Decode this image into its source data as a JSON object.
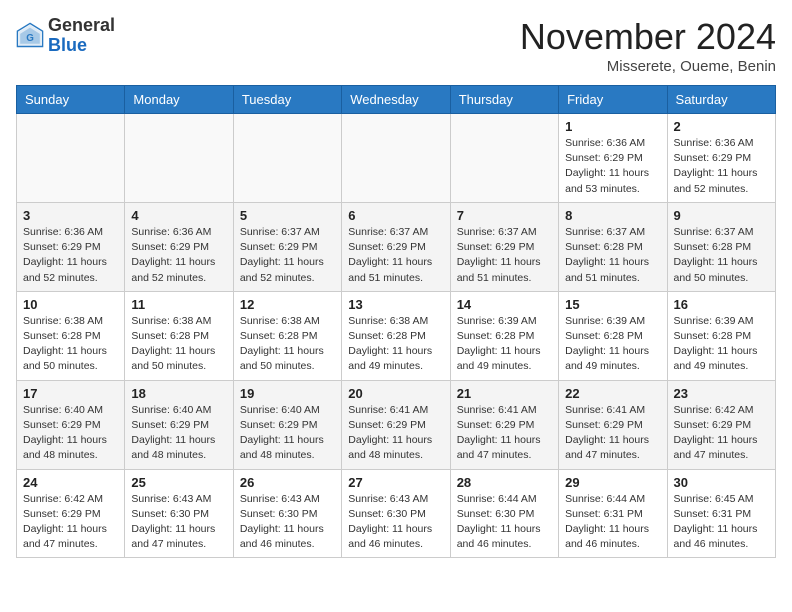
{
  "header": {
    "logo_general": "General",
    "logo_blue": "Blue",
    "month_title": "November 2024",
    "location": "Misserete, Oueme, Benin"
  },
  "weekdays": [
    "Sunday",
    "Monday",
    "Tuesday",
    "Wednesday",
    "Thursday",
    "Friday",
    "Saturday"
  ],
  "weeks": [
    [
      {
        "day": "",
        "detail": ""
      },
      {
        "day": "",
        "detail": ""
      },
      {
        "day": "",
        "detail": ""
      },
      {
        "day": "",
        "detail": ""
      },
      {
        "day": "",
        "detail": ""
      },
      {
        "day": "1",
        "detail": "Sunrise: 6:36 AM\nSunset: 6:29 PM\nDaylight: 11 hours\nand 53 minutes."
      },
      {
        "day": "2",
        "detail": "Sunrise: 6:36 AM\nSunset: 6:29 PM\nDaylight: 11 hours\nand 52 minutes."
      }
    ],
    [
      {
        "day": "3",
        "detail": "Sunrise: 6:36 AM\nSunset: 6:29 PM\nDaylight: 11 hours\nand 52 minutes."
      },
      {
        "day": "4",
        "detail": "Sunrise: 6:36 AM\nSunset: 6:29 PM\nDaylight: 11 hours\nand 52 minutes."
      },
      {
        "day": "5",
        "detail": "Sunrise: 6:37 AM\nSunset: 6:29 PM\nDaylight: 11 hours\nand 52 minutes."
      },
      {
        "day": "6",
        "detail": "Sunrise: 6:37 AM\nSunset: 6:29 PM\nDaylight: 11 hours\nand 51 minutes."
      },
      {
        "day": "7",
        "detail": "Sunrise: 6:37 AM\nSunset: 6:29 PM\nDaylight: 11 hours\nand 51 minutes."
      },
      {
        "day": "8",
        "detail": "Sunrise: 6:37 AM\nSunset: 6:28 PM\nDaylight: 11 hours\nand 51 minutes."
      },
      {
        "day": "9",
        "detail": "Sunrise: 6:37 AM\nSunset: 6:28 PM\nDaylight: 11 hours\nand 50 minutes."
      }
    ],
    [
      {
        "day": "10",
        "detail": "Sunrise: 6:38 AM\nSunset: 6:28 PM\nDaylight: 11 hours\nand 50 minutes."
      },
      {
        "day": "11",
        "detail": "Sunrise: 6:38 AM\nSunset: 6:28 PM\nDaylight: 11 hours\nand 50 minutes."
      },
      {
        "day": "12",
        "detail": "Sunrise: 6:38 AM\nSunset: 6:28 PM\nDaylight: 11 hours\nand 50 minutes."
      },
      {
        "day": "13",
        "detail": "Sunrise: 6:38 AM\nSunset: 6:28 PM\nDaylight: 11 hours\nand 49 minutes."
      },
      {
        "day": "14",
        "detail": "Sunrise: 6:39 AM\nSunset: 6:28 PM\nDaylight: 11 hours\nand 49 minutes."
      },
      {
        "day": "15",
        "detail": "Sunrise: 6:39 AM\nSunset: 6:28 PM\nDaylight: 11 hours\nand 49 minutes."
      },
      {
        "day": "16",
        "detail": "Sunrise: 6:39 AM\nSunset: 6:28 PM\nDaylight: 11 hours\nand 49 minutes."
      }
    ],
    [
      {
        "day": "17",
        "detail": "Sunrise: 6:40 AM\nSunset: 6:29 PM\nDaylight: 11 hours\nand 48 minutes."
      },
      {
        "day": "18",
        "detail": "Sunrise: 6:40 AM\nSunset: 6:29 PM\nDaylight: 11 hours\nand 48 minutes."
      },
      {
        "day": "19",
        "detail": "Sunrise: 6:40 AM\nSunset: 6:29 PM\nDaylight: 11 hours\nand 48 minutes."
      },
      {
        "day": "20",
        "detail": "Sunrise: 6:41 AM\nSunset: 6:29 PM\nDaylight: 11 hours\nand 48 minutes."
      },
      {
        "day": "21",
        "detail": "Sunrise: 6:41 AM\nSunset: 6:29 PM\nDaylight: 11 hours\nand 47 minutes."
      },
      {
        "day": "22",
        "detail": "Sunrise: 6:41 AM\nSunset: 6:29 PM\nDaylight: 11 hours\nand 47 minutes."
      },
      {
        "day": "23",
        "detail": "Sunrise: 6:42 AM\nSunset: 6:29 PM\nDaylight: 11 hours\nand 47 minutes."
      }
    ],
    [
      {
        "day": "24",
        "detail": "Sunrise: 6:42 AM\nSunset: 6:29 PM\nDaylight: 11 hours\nand 47 minutes."
      },
      {
        "day": "25",
        "detail": "Sunrise: 6:43 AM\nSunset: 6:30 PM\nDaylight: 11 hours\nand 47 minutes."
      },
      {
        "day": "26",
        "detail": "Sunrise: 6:43 AM\nSunset: 6:30 PM\nDaylight: 11 hours\nand 46 minutes."
      },
      {
        "day": "27",
        "detail": "Sunrise: 6:43 AM\nSunset: 6:30 PM\nDaylight: 11 hours\nand 46 minutes."
      },
      {
        "day": "28",
        "detail": "Sunrise: 6:44 AM\nSunset: 6:30 PM\nDaylight: 11 hours\nand 46 minutes."
      },
      {
        "day": "29",
        "detail": "Sunrise: 6:44 AM\nSunset: 6:31 PM\nDaylight: 11 hours\nand 46 minutes."
      },
      {
        "day": "30",
        "detail": "Sunrise: 6:45 AM\nSunset: 6:31 PM\nDaylight: 11 hours\nand 46 minutes."
      }
    ]
  ]
}
